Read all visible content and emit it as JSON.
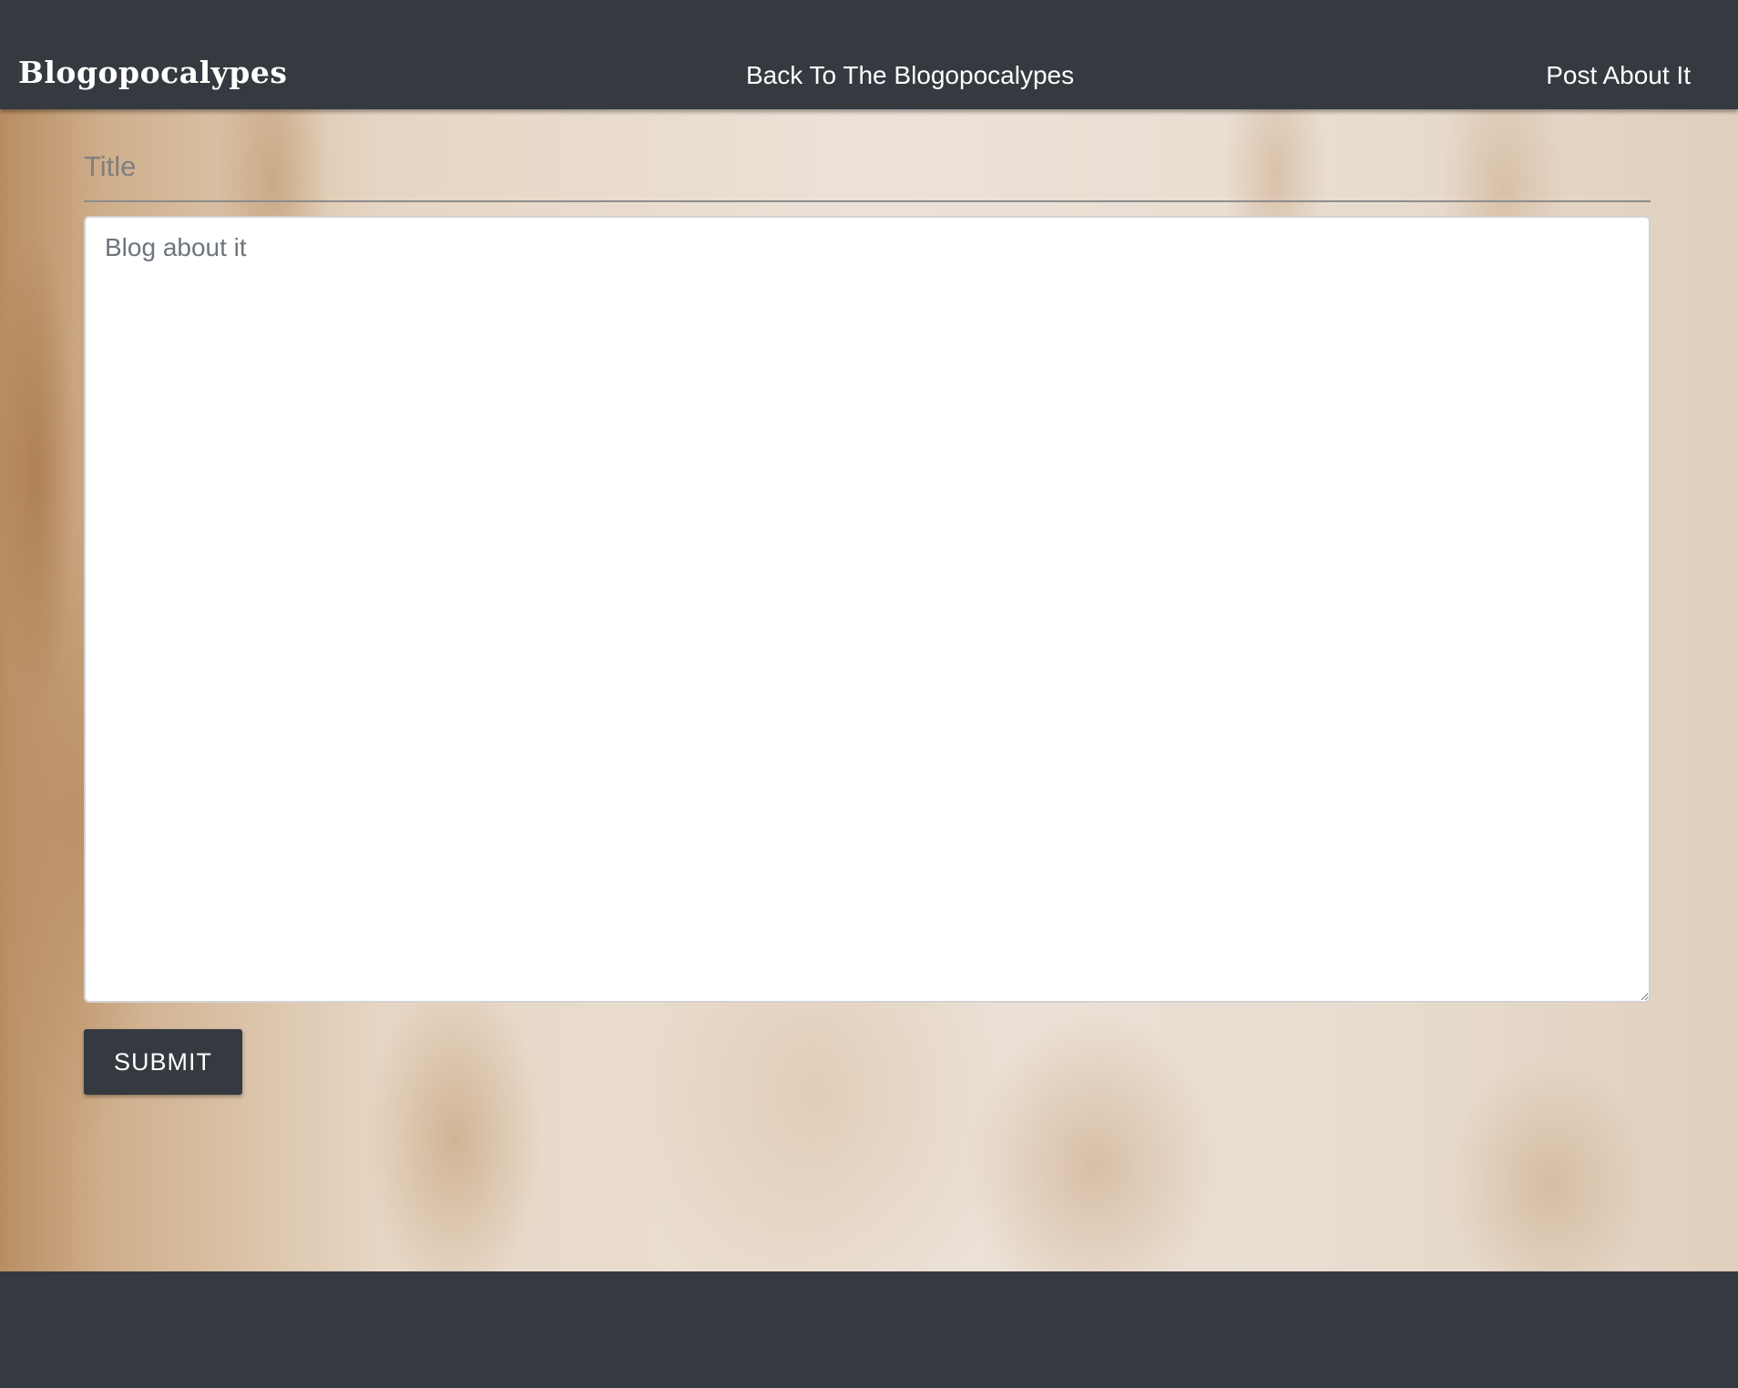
{
  "navbar": {
    "brand": "Blogopocalypes",
    "links": [
      {
        "label": "Back To The Blogopocalypes"
      },
      {
        "label": "Post About It"
      }
    ]
  },
  "form": {
    "title_placeholder": "Title",
    "title_value": "",
    "body_placeholder": "Blog about it",
    "body_value": "",
    "submit_label": "SUBMIT"
  },
  "colors": {
    "navbar_bg": "#343a40",
    "footer_bg": "#343a40",
    "button_bg": "#343a40",
    "text_light": "#ffffff"
  }
}
